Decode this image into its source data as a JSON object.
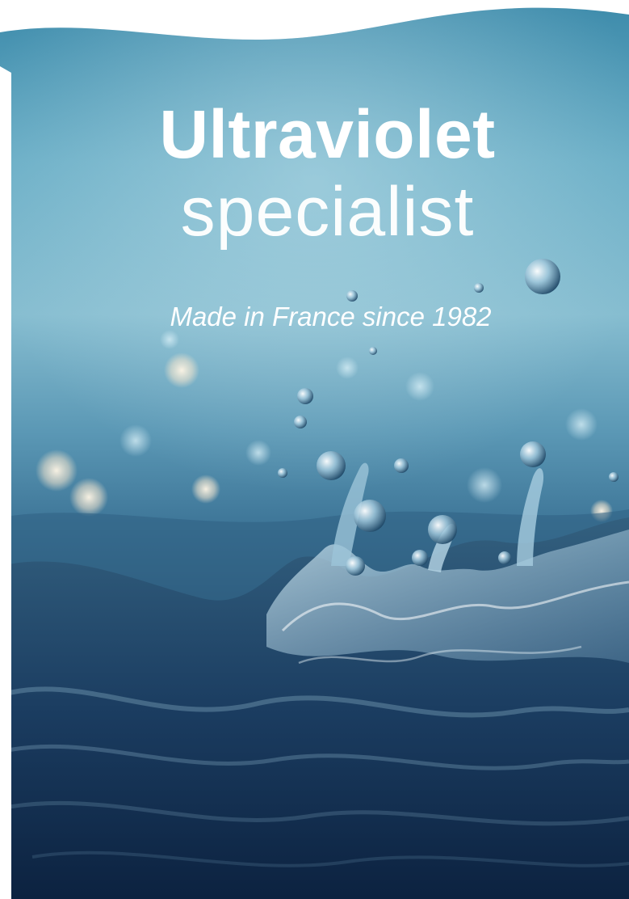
{
  "hero": {
    "title_bold": "Ultraviolet",
    "title_light": "specialist",
    "tagline": "Made in France since 1982"
  },
  "photo": {
    "subject": "water-splash-icon"
  },
  "colors": {
    "sky_top": "#3f8fae",
    "sky_mid": "#7db6cb",
    "water_deep": "#0f2a4a",
    "water_mid": "#2b5577",
    "text": "#ffffff"
  }
}
